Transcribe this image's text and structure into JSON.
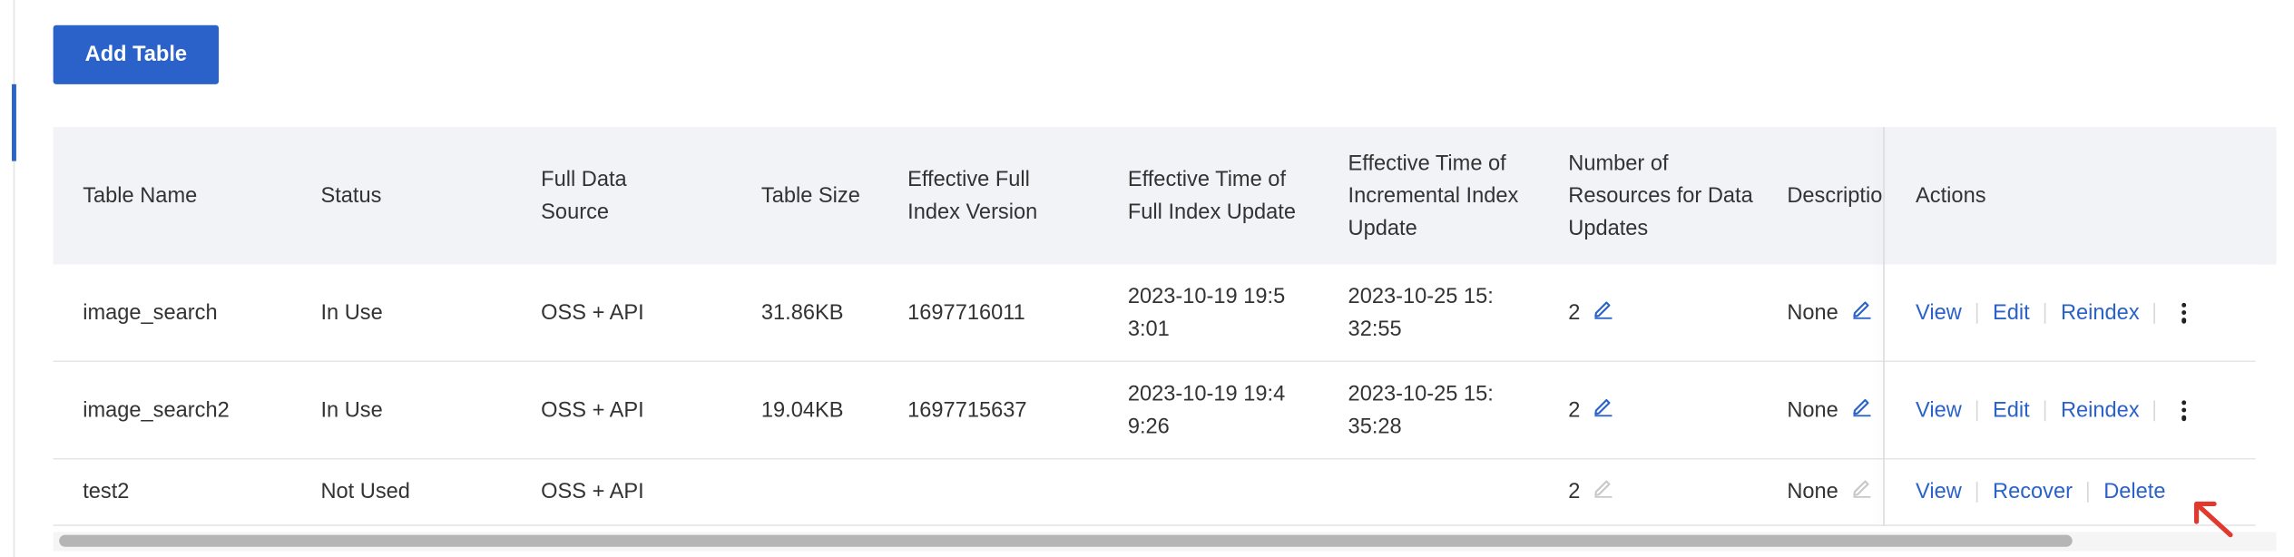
{
  "toolbar": {
    "add_table_label": "Add Table"
  },
  "table": {
    "columns": [
      "Table Name",
      "Status",
      "Full Data Source",
      "Table Size",
      "Effective Full Index Version",
      "Effective Time of Full Index Update",
      "Effective Time of Incremental Index Update",
      "Number of Resources for Data Updates",
      "Descriptio",
      "Actions"
    ],
    "rows": [
      {
        "name": "image_search",
        "status": "In Use",
        "source": "OSS + API",
        "size": "31.86KB",
        "version": "1697716011",
        "full_time": "2023-10-19 19:53:01",
        "incr_time": "2023-10-25 15:32:55",
        "resources": "2",
        "description": "None",
        "actions": [
          "View",
          "Edit",
          "Reindex"
        ]
      },
      {
        "name": "image_search2",
        "status": "In Use",
        "source": "OSS + API",
        "size": "19.04KB",
        "version": "1697715637",
        "full_time": "2023-10-19 19:49:26",
        "incr_time": "2023-10-25 15:35:28",
        "resources": "2",
        "description": "None",
        "actions": [
          "View",
          "Edit",
          "Reindex"
        ]
      },
      {
        "name": "test2",
        "status": "Not Used",
        "source": "OSS + API",
        "size": "",
        "version": "",
        "full_time": "",
        "incr_time": "",
        "resources": "2",
        "description": "None",
        "actions": [
          "View",
          "Recover",
          "Delete"
        ]
      }
    ]
  },
  "colors": {
    "accent": "#2a62c9",
    "header_bg": "#f1f3f6",
    "annotation_arrow": "#e03a2f"
  }
}
